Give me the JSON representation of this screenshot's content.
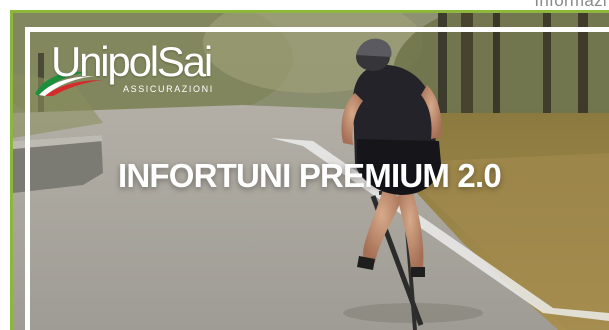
{
  "header": {
    "corner_text": "Informazi"
  },
  "banner": {
    "brand_name": "UnipolSai",
    "brand_sub": "ASSICURAZIONI",
    "headline": "INFORTUNI PREMIUM 2.0",
    "frame_color": "#8cb63c",
    "flag_colors": [
      "#1c8f3c",
      "#ffffff",
      "#d42b2b"
    ]
  }
}
